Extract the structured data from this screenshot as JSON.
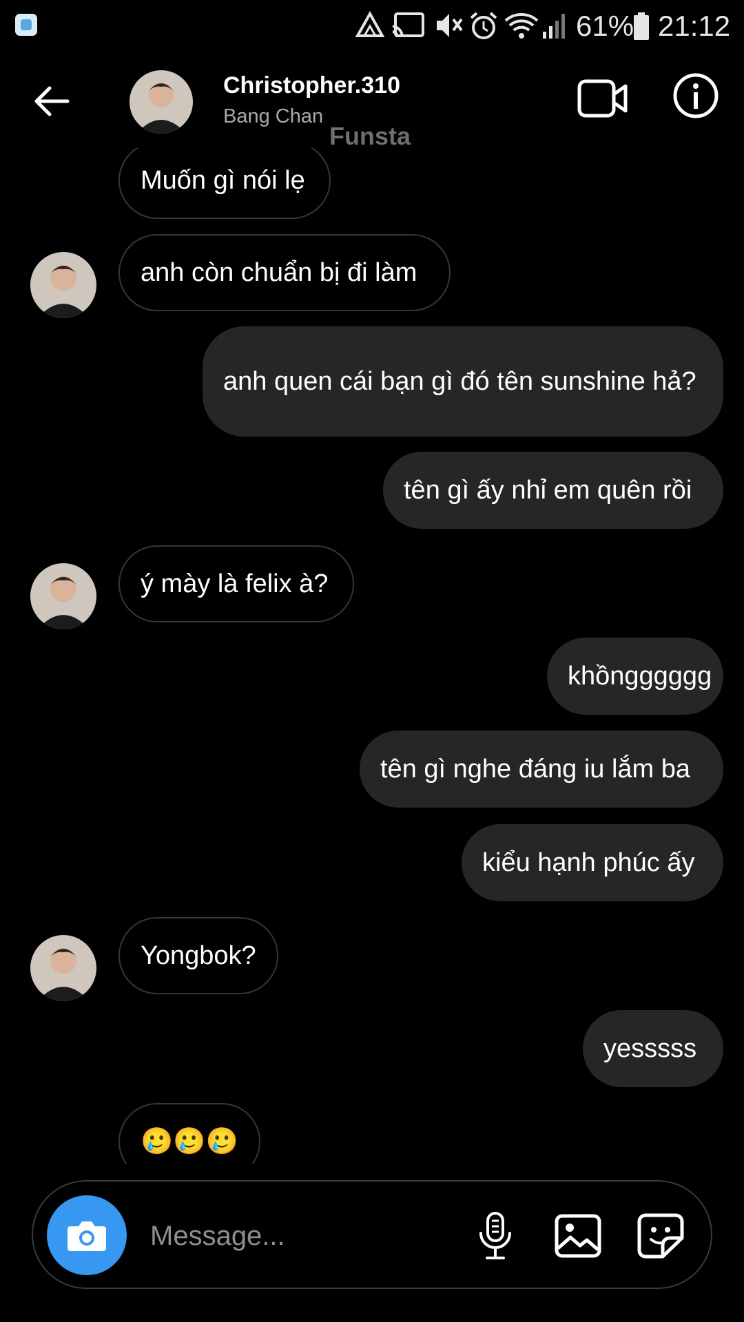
{
  "status_bar": {
    "battery": "61%",
    "time": "21:12",
    "icons": [
      "app-notification-icon",
      "drive-icon",
      "cast-icon",
      "mute-icon",
      "alarm-icon",
      "wifi-icon",
      "signal-icon",
      "battery-icon"
    ]
  },
  "header": {
    "username": "Christopher.310",
    "full_name": "Bang Chan",
    "watermark": "Funsta",
    "icons": [
      "back-arrow-icon",
      "video-call-icon",
      "info-icon"
    ]
  },
  "messages": [
    {
      "from": "them",
      "text": "Muốn gì nói lẹ"
    },
    {
      "from": "them",
      "text": "anh còn chuẩn bị đi làm"
    },
    {
      "from": "me",
      "text": "anh quen cái bạn gì đó tên sunshine hả?"
    },
    {
      "from": "me",
      "text": "tên gì ấy nhỉ em quên rồi"
    },
    {
      "from": "them",
      "text": "ý mày là felix à?"
    },
    {
      "from": "me",
      "text": "khồngggggg"
    },
    {
      "from": "me",
      "text": "tên gì nghe đáng iu lắm ba"
    },
    {
      "from": "me",
      "text": "kiểu hạnh phúc ấy"
    },
    {
      "from": "them",
      "text": "Yongbok?"
    },
    {
      "from": "me",
      "text": "yesssss"
    },
    {
      "from": "them",
      "text": "🥲🥲🥲"
    }
  ],
  "composer": {
    "placeholder": "Message...",
    "icons": [
      "camera-icon",
      "microphone-icon",
      "gallery-icon",
      "sticker-icon"
    ]
  },
  "colors": {
    "background": "#000000",
    "outgoing_bubble": "#262626",
    "incoming_border": "#363636",
    "camera_button": "#3897f0",
    "secondary_text": "#a8a8a8"
  }
}
